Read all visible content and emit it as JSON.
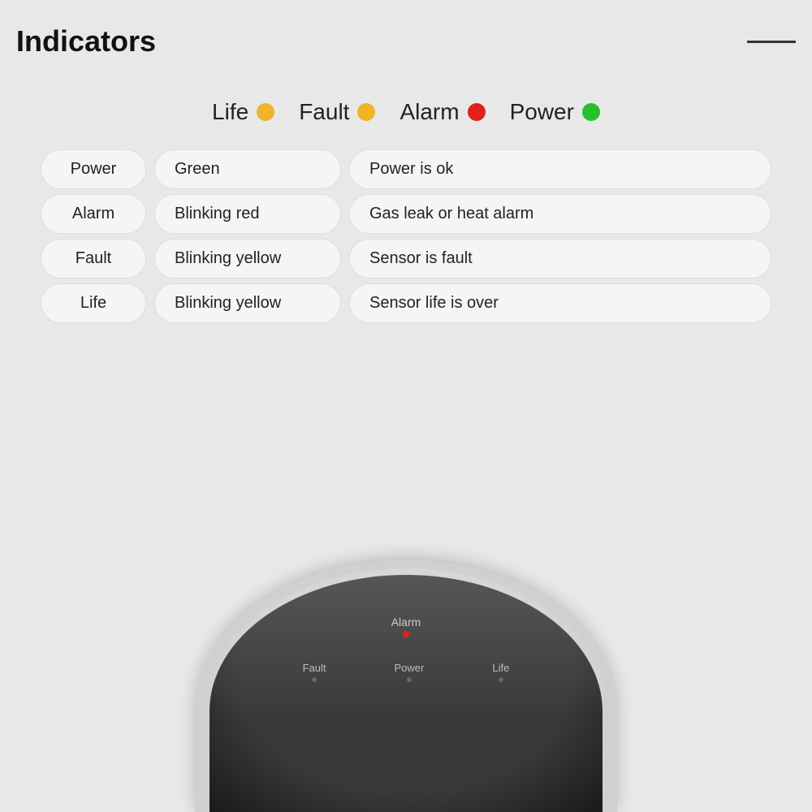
{
  "header": {
    "title": "Indicators",
    "line": true
  },
  "legend": {
    "items": [
      {
        "label": "Life",
        "dot_color": "yellow",
        "dot_class": "dot-yellow"
      },
      {
        "label": "Fault",
        "dot_color": "yellow",
        "dot_class": "dot-yellow"
      },
      {
        "label": "Alarm",
        "dot_color": "red",
        "dot_class": "dot-red"
      },
      {
        "label": "Power",
        "dot_color": "green",
        "dot_class": "dot-green"
      }
    ]
  },
  "table": {
    "rows": [
      {
        "indicator": "Power",
        "color": "Green",
        "description": "Power is ok"
      },
      {
        "indicator": "Alarm",
        "color": "Blinking red",
        "description": "Gas leak or heat alarm"
      },
      {
        "indicator": "Fault",
        "color": "Blinking yellow",
        "description": "Sensor is fault"
      },
      {
        "indicator": "Life",
        "color": "Blinking yellow",
        "description": "Sensor life is over"
      }
    ]
  },
  "device": {
    "alarm_label": "Alarm",
    "fault_label": "Fault",
    "power_label": "Power",
    "life_label": "Life"
  }
}
